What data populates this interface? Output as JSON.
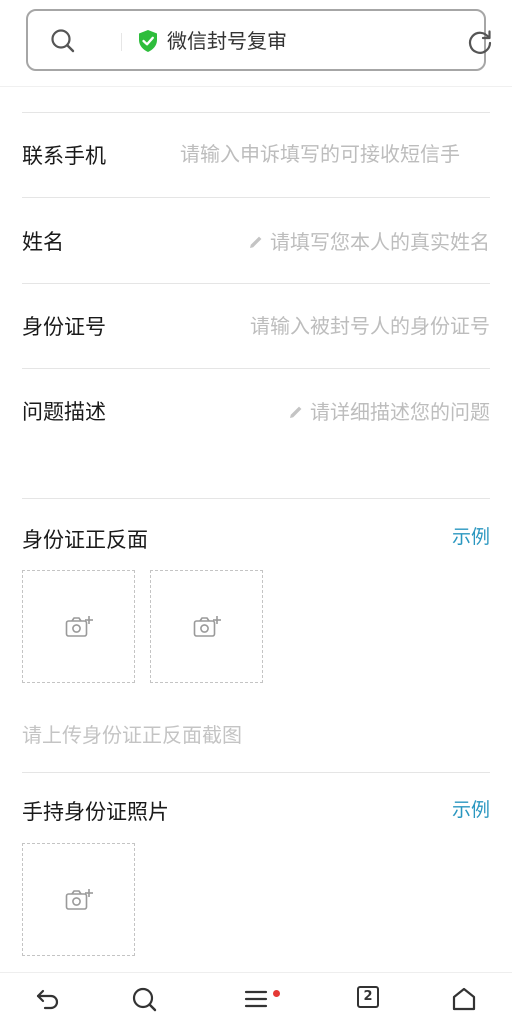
{
  "browser": {
    "page_title": "微信封号复审",
    "icons": {
      "search": "search-icon",
      "secure": "shield-check-icon",
      "refresh": "refresh-icon"
    },
    "secure_color": "#2ebd3c"
  },
  "form": {
    "phone": {
      "label": "联系手机",
      "placeholder": "请输入申诉填写的可接收短信手"
    },
    "name": {
      "label": "姓名",
      "placeholder": "请填写您本人的真实姓名"
    },
    "id_number": {
      "label": "身份证号",
      "placeholder": "请输入被封号人的身份证号"
    },
    "description": {
      "label": "问题描述",
      "placeholder": "请详细描述您的问题"
    }
  },
  "id_card": {
    "label": "身份证正反面",
    "example": "示例",
    "hint": "请上传身份证正反面截图"
  },
  "hand_photo": {
    "label": "手持身份证照片",
    "example": "示例"
  },
  "accent_color": "#2a97c0",
  "nav": {
    "tab_count": "2",
    "icons": [
      "back-icon",
      "search-icon",
      "menu-icon",
      "tabs-icon",
      "home-icon"
    ],
    "notification_color": "#e53935"
  }
}
